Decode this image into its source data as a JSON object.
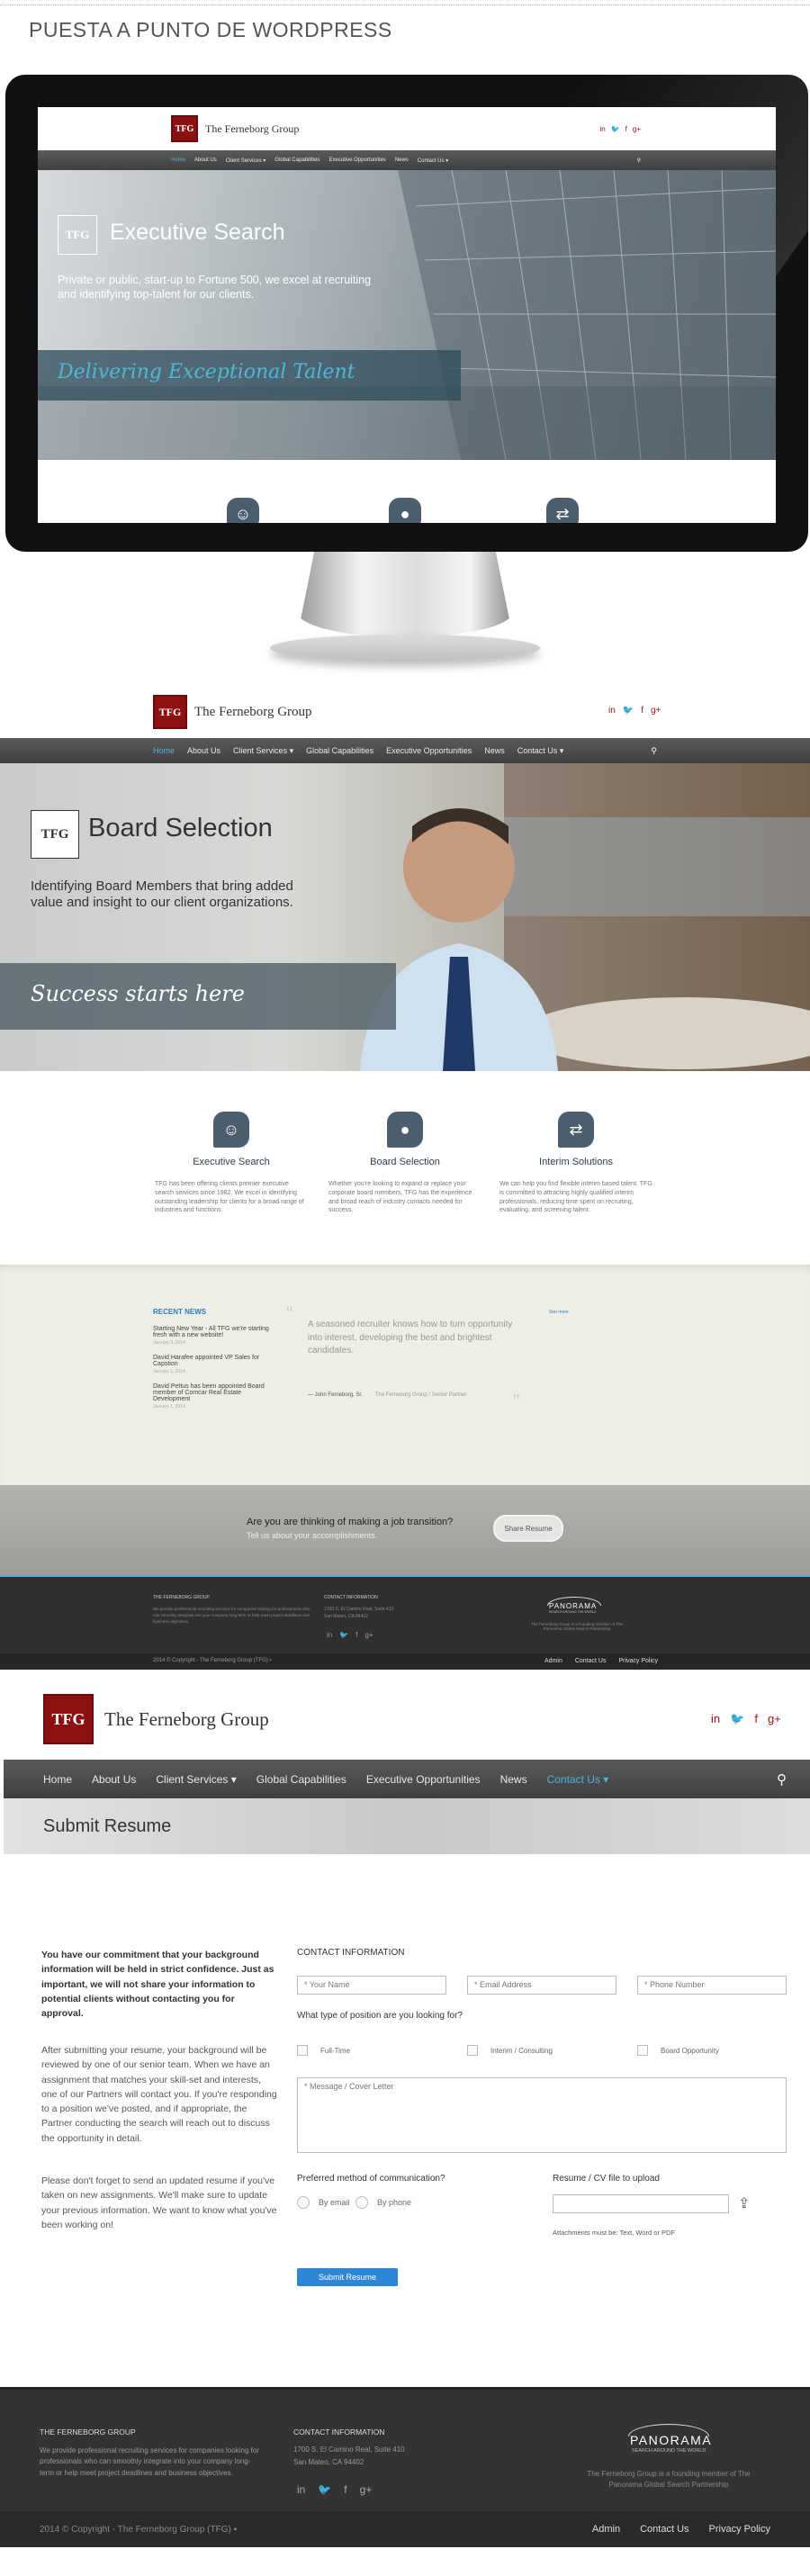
{
  "page_title": "PUESTA A PUNTO DE WORDPRESS",
  "brand": {
    "logo_abbr": "TFG",
    "logo_name": "The Ferneborg Group",
    "social": [
      "in",
      "🐦",
      "f",
      "g+"
    ]
  },
  "nav": {
    "items": [
      "Home",
      "About Us",
      "Client Services ▾",
      "Global Capabilities",
      "Executive Opportunities",
      "News",
      "Contact Us ▾"
    ],
    "search_icon": "search-icon"
  },
  "monitor_hero": {
    "badge": "TFG",
    "title": "Executive Search",
    "subtitle": "Private or public, start-up to Fortune 500, we excel at recruiting and identifying top-talent for our clients.",
    "tagline": "Delivering Exceptional Talent"
  },
  "board_hero": {
    "badge": "TFG",
    "title": "Board Selection",
    "subtitle": "Identifying Board Members that bring added value and insight to our client organizations.",
    "tagline": "Success starts here"
  },
  "features": [
    {
      "icon": "group-icon",
      "title": "Executive Search",
      "text": "TFG has been offering clients premier executive search services since 1982. We excel in identifying outstanding leadership for clients for a broad range of industries and functions."
    },
    {
      "icon": "person-icon",
      "title": "Board Selection",
      "text": "Whether you're looking to expand or replace your corporate board members, TFG has the experience and broad reach of industry contacts needed for success."
    },
    {
      "icon": "shuffle-icon",
      "title": "Interim Solutions",
      "text": "We can help you find flexible interim based talent. TFG is committed to attracting highly qualified interim professionals, reducing time spent on recruiting, evaluating, and screening talent."
    }
  ],
  "recent_news": {
    "heading": "RECENT NEWS",
    "items": [
      {
        "title": "Starting New Year - All TFG we're starting fresh with a new website!",
        "date": "January 3, 2014"
      },
      {
        "title": "David Harafee appointed VP Sales for Capstion",
        "date": "January 1, 2014"
      },
      {
        "title": "David Pettus has been appointed Board member of Comcar Real Estate Development",
        "date": "January 1, 2014"
      }
    ],
    "see_more": "See more"
  },
  "testimonial": {
    "quote": "A seasoned recruiter knows how to turn opportunity into interest, developing the best and brightest candidates.",
    "author": "— John Ferneborg, Sr.",
    "author_title": "The Ferneborg Group / Senior Partner"
  },
  "cta": {
    "heading": "Are you are thinking of making a job transition?",
    "sub": "Tell us about your accomplishments.",
    "button": "Share Resume"
  },
  "footer_small": {
    "col1_head": "THE FERNEBORG GROUP",
    "col1_text": "We provide professional recruiting services for companies looking for professionals who can smoothly integrate into your company long-term or help meet project deadlines and business objectives.",
    "col2_head": "CONTACT INFORMATION",
    "col2_addr1": "1700 S. El Camino Real, Suite 410",
    "col2_addr2": "San Mateo, CA 94402",
    "panorama": "PANORAMA",
    "panorama_sub": "SEARCH AROUND THE WORLD",
    "panorama_note": "The Ferneborg Group is a founding member of The Panorama Global Search Partnership",
    "copyright": "2014 © Copyright - The Ferneborg Group (TFG) ▪",
    "links": [
      "Admin",
      "Contact Us",
      "Privacy Policy"
    ]
  },
  "submit_page": {
    "banner": "Submit Resume",
    "intro_bold": "You have our commitment that your background information will be held in strict confidence. Just as important, we will not share your information to potential clients without contacting you for approval.",
    "para2": "After submitting your resume, your background will be reviewed by one of our senior team. When we have an assignment that matches your skill-set and interests, one of our Partners will contact you. If you're responding to a position we've posted, and if appropriate, the Partner conducting the search will reach out to discuss the opportunity in detail.",
    "para3": "Please don't forget to send an updated resume if you've taken on new assignments. We'll make sure to update your previous information. We want to know what you've been working on!",
    "contact_heading": "CONTACT INFORMATION",
    "placeholders": {
      "name": "* Your Name",
      "email": "* Email Address",
      "phone": "* Phone Number",
      "message": "* Message / Cover Letter"
    },
    "position_q": "What type of position are you looking for?",
    "positions": [
      "Full-Time",
      "Interim / Consulting",
      "Board Opportunity"
    ],
    "comm_q": "Preferred method of communication?",
    "comm_opts": [
      "By email",
      "By phone"
    ],
    "resume_label": "Resume / CV file to upload",
    "attach_note": "Attachments must be: Text, Word or PDF",
    "submit": "Submit Resume"
  },
  "footer_large": {
    "col1_head": "THE FERNEBORG GROUP",
    "col1_text": "We provide professional recruiting services for companies looking for professionals who can smoothly integrate into your company long-term or help meet project deadlines and business objectives.",
    "col2_head": "CONTACT INFORMATION",
    "col2_addr1": "1700 S. El Camino Real, Suite 410",
    "col2_addr2": "San Mateo, CA 94402",
    "panorama": "PANORAMA",
    "panorama_sub": "SEARCH AROUND THE WORLD",
    "panorama_note": "The Ferneborg Group is a founding member of The Panorama Global Search Partnership",
    "copyright": "2014 © Copyright - The Ferneborg Group (TFG) ▪",
    "links": [
      "Admin",
      "Contact Us",
      "Privacy Policy"
    ]
  },
  "colors": {
    "brand_red": "#8c1111",
    "accent_blue": "#4fb0e2",
    "submit_blue": "#2f86d6",
    "dark": "#333333"
  }
}
